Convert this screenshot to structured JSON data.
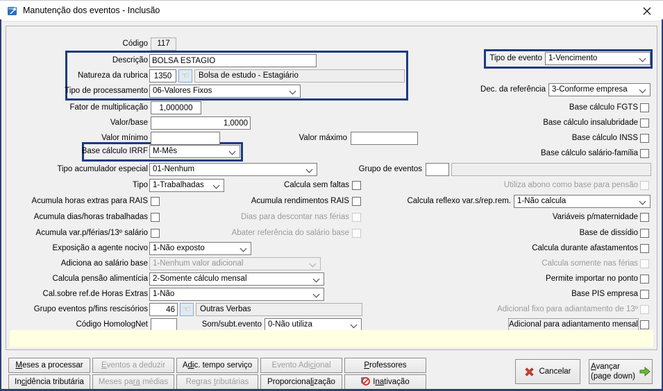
{
  "window": {
    "title": "Manutenção dos eventos - Inclusão"
  },
  "colors": {
    "accent_border": "#1b3a80",
    "info_panel_bg": "#ffffe1",
    "window_bg": "#f0f0f0",
    "titlebar_bg": "#ffffff",
    "cancel_red": "#cf3a2a",
    "advance_green": "#63b52f",
    "lookup_hand": "#e89b00"
  },
  "icons": {
    "lookup_glyph": "☜"
  },
  "fields": {
    "codigo": {
      "label": "Código",
      "value": "117"
    },
    "descricao": {
      "label": "Descrição",
      "value": "BOLSA ESTAGIO"
    },
    "natureza_rubrica": {
      "label": "Natureza da rubrica",
      "code": "1350",
      "desc": "Bolsa de estudo - Estagiário"
    },
    "tipo_processamento": {
      "label": "Tipo de processamento",
      "value": "06-Valores Fixos"
    },
    "tipo_evento": {
      "label": "Tipo de evento",
      "value": "1-Vencimento"
    },
    "dec_referencia": {
      "label": "Dec. da referência",
      "value": "3-Conforme empresa"
    },
    "fator_multiplicacao": {
      "label": "Fator de multiplicação",
      "value": "1,000000"
    },
    "valor_base": {
      "label": "Valor/base",
      "value": "1,0000"
    },
    "valor_minimo": {
      "label": "Valor mínimo",
      "value": ""
    },
    "valor_maximo": {
      "label": "Valor máximo",
      "value": ""
    },
    "base_calculo_irrf": {
      "label": "Base cálculo IRRF",
      "value": "M-Mês"
    },
    "tipo_acumulador_especial": {
      "label": "Tipo acumulador especial",
      "value": "01-Nenhum"
    },
    "grupo_de_eventos": {
      "label": "Grupo de eventos",
      "code": "",
      "desc": ""
    },
    "tipo": {
      "label": "Tipo",
      "value": "1-Trabalhadas"
    },
    "calcula_reflexo": {
      "label": "Calcula reflexo var.s/rep.rem.",
      "value": "1-Não calcula"
    },
    "exposicao_agente_nocivo": {
      "label": "Exposição a agente nocivo",
      "value": "1-Não exposto"
    },
    "adiciona_salario_base": {
      "label": "Adiciona ao salário base",
      "value": "1-Nenhum valor adicional"
    },
    "calcula_pensao": {
      "label": "Calcula pensão alimentícia",
      "value": "2-Somente cálculo mensal"
    },
    "cal_sobre_horas_extras": {
      "label": "Cal.sobre ref.de Horas Extras",
      "value": "1-Não"
    },
    "grupo_rescisorios": {
      "label": "Grupo eventos p/fins rescisórios",
      "code": "46",
      "desc": "Outras Verbas"
    },
    "codigo_homolognet": {
      "label": "Código HomologNet",
      "value": ""
    },
    "som_subt_evento": {
      "label": "Som/subt.evento",
      "value": "0-Não utiliza"
    }
  },
  "checks": {
    "base_fgts": {
      "label": "Base cálculo FGTS",
      "checked": false,
      "enabled": true
    },
    "base_insalubridade": {
      "label": "Base cálculo insalubridade",
      "checked": false,
      "enabled": true
    },
    "base_inss": {
      "label": "Base cálculo INSS",
      "checked": false,
      "enabled": true
    },
    "base_salario_familia": {
      "label": "Base cálculo salário-família",
      "checked": false,
      "enabled": true
    },
    "calcula_sem_faltas": {
      "label": "Calcula sem faltas",
      "checked": false,
      "enabled": true
    },
    "utiliza_abono": {
      "label": "Utiliza abono como base para pensão",
      "checked": false,
      "enabled": false
    },
    "acumula_horas_extras_rais": {
      "label": "Acumula horas extras para RAIS",
      "checked": false,
      "enabled": true
    },
    "acumula_rendimentos_rais": {
      "label": "Acumula rendimentos RAIS",
      "checked": false,
      "enabled": true
    },
    "acumula_dias_horas": {
      "label": "Acumula dias/horas trabalhadas",
      "checked": false,
      "enabled": true
    },
    "dias_descontar_ferias": {
      "label": "Dias para descontar nas férias",
      "checked": false,
      "enabled": false
    },
    "acumula_var_ferias_13": {
      "label": "Acumula var.p/férias/13º salário",
      "checked": false,
      "enabled": true
    },
    "abater_referencia_salario": {
      "label": "Abater referência do salário base",
      "checked": false,
      "enabled": false
    },
    "variaveis_maternidade": {
      "label": "Variáveis p/maternidade",
      "checked": false,
      "enabled": true
    },
    "base_dissidio": {
      "label": "Base de dissídio",
      "checked": false,
      "enabled": true
    },
    "calcula_durante_afastamentos": {
      "label": "Calcula durante afastamentos",
      "checked": false,
      "enabled": true
    },
    "calcula_somente_ferias": {
      "label": "Calcula somente nas férias",
      "checked": false,
      "enabled": false
    },
    "permite_importar_ponto": {
      "label": "Permite importar no ponto",
      "checked": false,
      "enabled": true
    },
    "base_pis_empresa": {
      "label": "Base PIS empresa",
      "checked": false,
      "enabled": true
    },
    "adicional_fixo_13": {
      "label": "Adicional fixo para adiantamento de 13º",
      "checked": false,
      "enabled": false
    },
    "adicional_adiantamento_mensal": {
      "label": "Adicional para adiantamento mensal",
      "checked": false,
      "enabled": true,
      "focused": true
    }
  },
  "action_buttons": [
    {
      "pre": "",
      "u": "M",
      "post": "eses a processar",
      "disabled": false
    },
    {
      "pre": "",
      "u": "E",
      "post": "ventos a deduzir",
      "disabled": true
    },
    {
      "pre": "A",
      "u": "di",
      "post": "c. tempo serviço",
      "disabled": false
    },
    {
      "pre": "Evento Adi",
      "u": "ci",
      "post": "onal",
      "disabled": true
    },
    {
      "pre": "",
      "u": "P",
      "post": "rofessores",
      "disabled": false
    },
    {
      "pre": "In",
      "u": "ci",
      "post": "dência tributária",
      "disabled": false
    },
    {
      "pre": "Meses pa",
      "u": "ra",
      "post": " médias",
      "disabled": true
    },
    {
      "pre": "Regras ",
      "u": "t",
      "post": "ributárias",
      "disabled": true
    },
    {
      "pre": "Proporciona",
      "u": "li",
      "post": "zação",
      "disabled": false
    },
    {
      "pre": "I",
      "u": "na",
      "post": "tivação",
      "disabled": false
    }
  ],
  "dialog_buttons": {
    "cancel": {
      "label": "Cancelar"
    },
    "advance": {
      "pre": "",
      "u": "A",
      "post": "vançar",
      "line2": "(page down)"
    }
  }
}
